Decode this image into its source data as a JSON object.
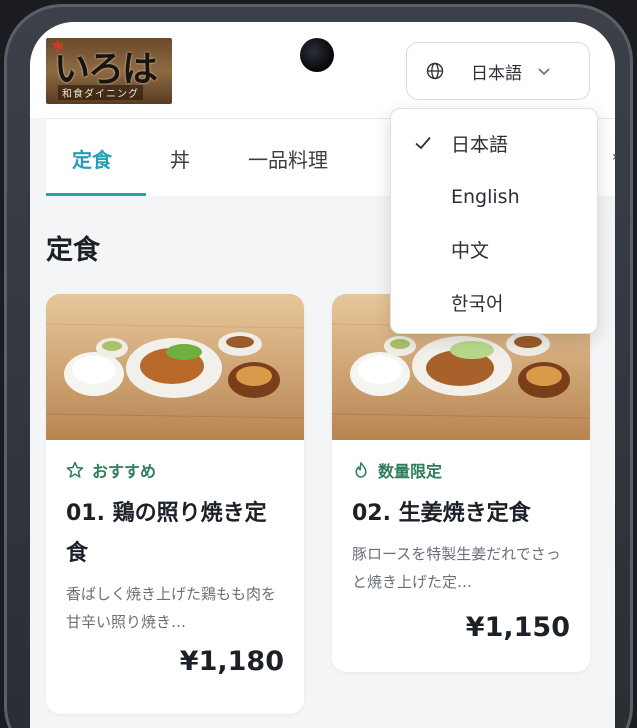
{
  "header": {
    "logo": {
      "main_text": "いろは",
      "sub_text": "和食ダイニング"
    },
    "language_button": {
      "label": "日本語",
      "icon": "globe-icon",
      "chevron": "chevron-down-icon"
    }
  },
  "tabs": [
    {
      "label": "定食",
      "active": true
    },
    {
      "label": "丼",
      "active": false
    },
    {
      "label": "一品料理",
      "active": false
    }
  ],
  "section": {
    "title": "定食"
  },
  "menu_items": [
    {
      "badge": {
        "icon": "star-icon",
        "label": "おすすめ"
      },
      "name": "01. 鶏の照り焼き定食",
      "description": "香ばしく焼き上げた鶏もも肉を甘辛い照り焼き…",
      "price": "¥1,180"
    },
    {
      "badge": {
        "icon": "flame-icon",
        "label": "数量限定"
      },
      "name": "02. 生姜焼き定食",
      "description": "豚ロースを特製生姜だれでさっと焼き上げた定…",
      "price": "¥1,150"
    }
  ],
  "language_dropdown": {
    "selected": "日本語",
    "options": [
      "日本語",
      "English",
      "中文",
      "한국어"
    ]
  },
  "colors": {
    "accent": "#2a9db8",
    "badge_green": "#2f7d5a",
    "text_dark": "#1c2027"
  }
}
